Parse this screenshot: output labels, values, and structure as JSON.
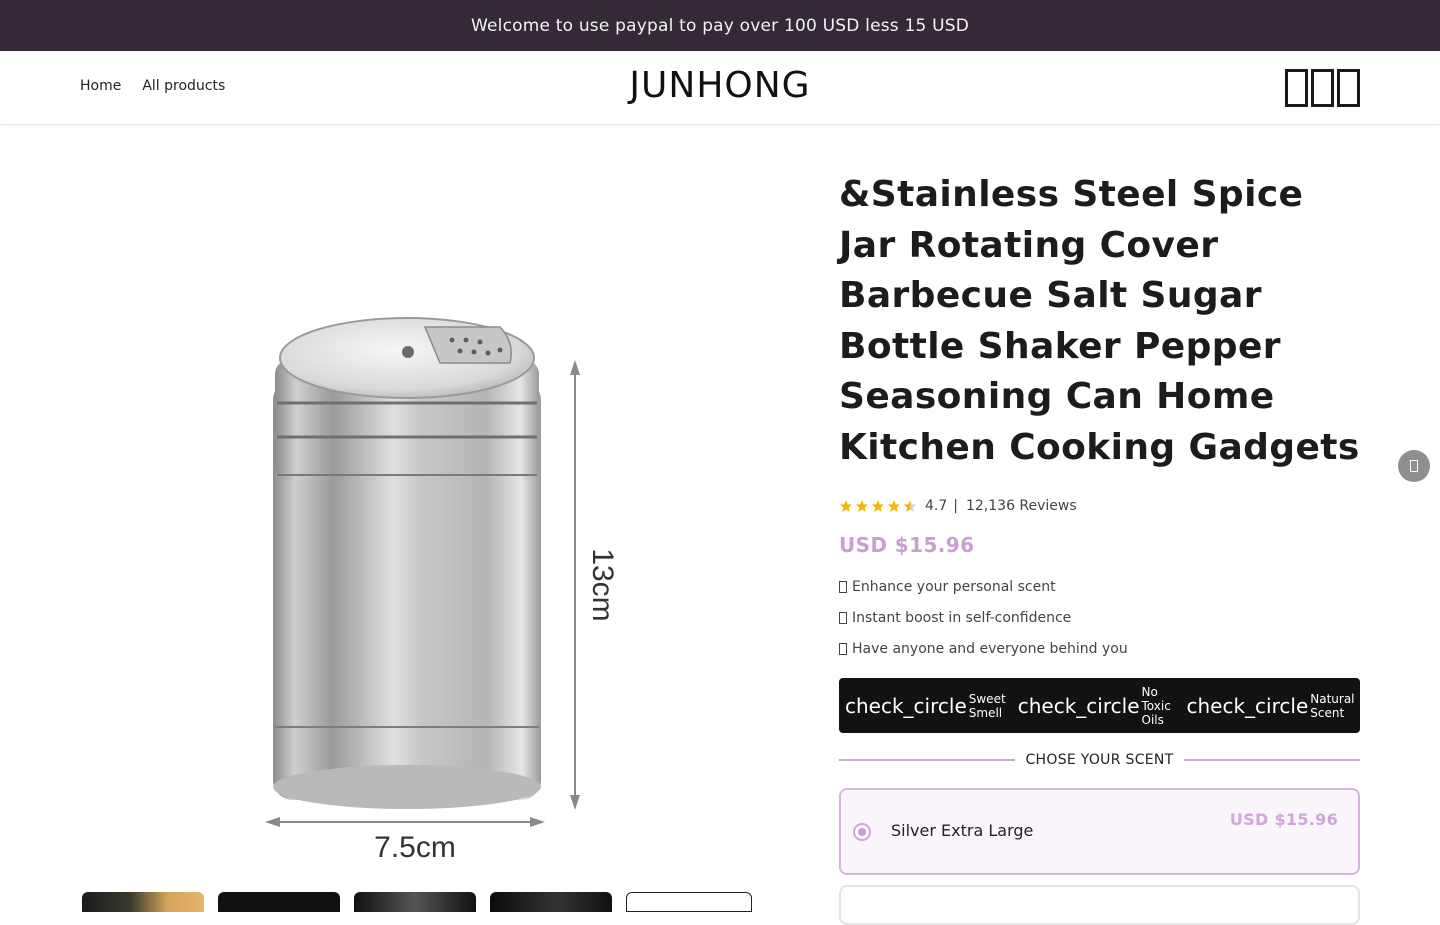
{
  "announcement": "Welcome to use paypal to pay over 100 USD less 15 USD",
  "header": {
    "nav": [
      "Home",
      "All products"
    ],
    "logo": "JUNHONG",
    "icons": [
      "search-icon",
      "account-icon",
      "cart-icon"
    ]
  },
  "product": {
    "title": "&Stainless Steel Spice Jar Rotating Cover Barbecue Salt Sugar Bottle Shaker Pepper Seasoning Can Home Kitchen Cooking Gadgets",
    "rating_value": "4.7",
    "rating_separator": "|",
    "reviews": "12,136 Reviews",
    "stars": 4.7,
    "price": "USD $15.96",
    "image_dimensions": {
      "height_label": "13cm",
      "width_label": "7.5cm"
    },
    "bullets": [
      "Enhance your personal scent",
      "Instant boost in self-confidence",
      "Have anyone and everyone behind you"
    ],
    "badges": [
      {
        "icon": "check_circle",
        "label": "Sweet Smell"
      },
      {
        "icon": "check_circle",
        "label": "No Toxic Oils"
      },
      {
        "icon": "check_circle",
        "label": "Natural Scent"
      }
    ],
    "scent_heading": "CHOSE YOUR SCENT",
    "options": [
      {
        "name": "Silver Extra Large",
        "price": "USD $15.96",
        "selected": true
      }
    ]
  },
  "colors": {
    "announcement_bg": "#342a36",
    "accent": "#c99fd1",
    "badge_bg": "#121212"
  }
}
